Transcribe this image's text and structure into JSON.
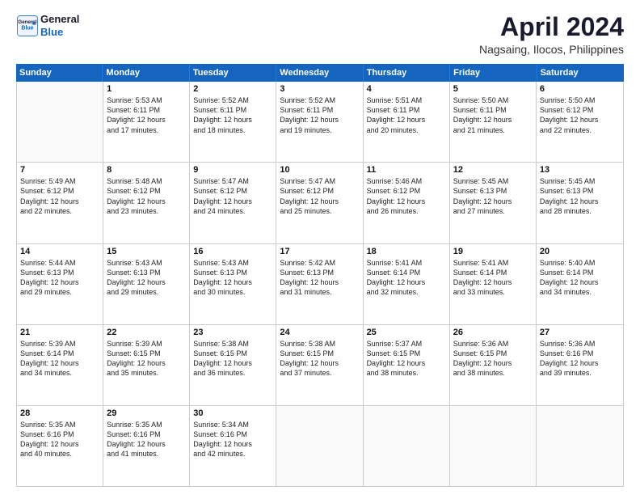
{
  "header": {
    "logo_line1": "General",
    "logo_line2": "Blue",
    "month": "April 2024",
    "location": "Nagsaing, Ilocos, Philippines"
  },
  "weekdays": [
    "Sunday",
    "Monday",
    "Tuesday",
    "Wednesday",
    "Thursday",
    "Friday",
    "Saturday"
  ],
  "rows": [
    [
      {
        "day": "",
        "lines": []
      },
      {
        "day": "1",
        "lines": [
          "Sunrise: 5:53 AM",
          "Sunset: 6:11 PM",
          "Daylight: 12 hours",
          "and 17 minutes."
        ]
      },
      {
        "day": "2",
        "lines": [
          "Sunrise: 5:52 AM",
          "Sunset: 6:11 PM",
          "Daylight: 12 hours",
          "and 18 minutes."
        ]
      },
      {
        "day": "3",
        "lines": [
          "Sunrise: 5:52 AM",
          "Sunset: 6:11 PM",
          "Daylight: 12 hours",
          "and 19 minutes."
        ]
      },
      {
        "day": "4",
        "lines": [
          "Sunrise: 5:51 AM",
          "Sunset: 6:11 PM",
          "Daylight: 12 hours",
          "and 20 minutes."
        ]
      },
      {
        "day": "5",
        "lines": [
          "Sunrise: 5:50 AM",
          "Sunset: 6:11 PM",
          "Daylight: 12 hours",
          "and 21 minutes."
        ]
      },
      {
        "day": "6",
        "lines": [
          "Sunrise: 5:50 AM",
          "Sunset: 6:12 PM",
          "Daylight: 12 hours",
          "and 22 minutes."
        ]
      }
    ],
    [
      {
        "day": "7",
        "lines": [
          "Sunrise: 5:49 AM",
          "Sunset: 6:12 PM",
          "Daylight: 12 hours",
          "and 22 minutes."
        ]
      },
      {
        "day": "8",
        "lines": [
          "Sunrise: 5:48 AM",
          "Sunset: 6:12 PM",
          "Daylight: 12 hours",
          "and 23 minutes."
        ]
      },
      {
        "day": "9",
        "lines": [
          "Sunrise: 5:47 AM",
          "Sunset: 6:12 PM",
          "Daylight: 12 hours",
          "and 24 minutes."
        ]
      },
      {
        "day": "10",
        "lines": [
          "Sunrise: 5:47 AM",
          "Sunset: 6:12 PM",
          "Daylight: 12 hours",
          "and 25 minutes."
        ]
      },
      {
        "day": "11",
        "lines": [
          "Sunrise: 5:46 AM",
          "Sunset: 6:12 PM",
          "Daylight: 12 hours",
          "and 26 minutes."
        ]
      },
      {
        "day": "12",
        "lines": [
          "Sunrise: 5:45 AM",
          "Sunset: 6:13 PM",
          "Daylight: 12 hours",
          "and 27 minutes."
        ]
      },
      {
        "day": "13",
        "lines": [
          "Sunrise: 5:45 AM",
          "Sunset: 6:13 PM",
          "Daylight: 12 hours",
          "and 28 minutes."
        ]
      }
    ],
    [
      {
        "day": "14",
        "lines": [
          "Sunrise: 5:44 AM",
          "Sunset: 6:13 PM",
          "Daylight: 12 hours",
          "and 29 minutes."
        ]
      },
      {
        "day": "15",
        "lines": [
          "Sunrise: 5:43 AM",
          "Sunset: 6:13 PM",
          "Daylight: 12 hours",
          "and 29 minutes."
        ]
      },
      {
        "day": "16",
        "lines": [
          "Sunrise: 5:43 AM",
          "Sunset: 6:13 PM",
          "Daylight: 12 hours",
          "and 30 minutes."
        ]
      },
      {
        "day": "17",
        "lines": [
          "Sunrise: 5:42 AM",
          "Sunset: 6:13 PM",
          "Daylight: 12 hours",
          "and 31 minutes."
        ]
      },
      {
        "day": "18",
        "lines": [
          "Sunrise: 5:41 AM",
          "Sunset: 6:14 PM",
          "Daylight: 12 hours",
          "and 32 minutes."
        ]
      },
      {
        "day": "19",
        "lines": [
          "Sunrise: 5:41 AM",
          "Sunset: 6:14 PM",
          "Daylight: 12 hours",
          "and 33 minutes."
        ]
      },
      {
        "day": "20",
        "lines": [
          "Sunrise: 5:40 AM",
          "Sunset: 6:14 PM",
          "Daylight: 12 hours",
          "and 34 minutes."
        ]
      }
    ],
    [
      {
        "day": "21",
        "lines": [
          "Sunrise: 5:39 AM",
          "Sunset: 6:14 PM",
          "Daylight: 12 hours",
          "and 34 minutes."
        ]
      },
      {
        "day": "22",
        "lines": [
          "Sunrise: 5:39 AM",
          "Sunset: 6:15 PM",
          "Daylight: 12 hours",
          "and 35 minutes."
        ]
      },
      {
        "day": "23",
        "lines": [
          "Sunrise: 5:38 AM",
          "Sunset: 6:15 PM",
          "Daylight: 12 hours",
          "and 36 minutes."
        ]
      },
      {
        "day": "24",
        "lines": [
          "Sunrise: 5:38 AM",
          "Sunset: 6:15 PM",
          "Daylight: 12 hours",
          "and 37 minutes."
        ]
      },
      {
        "day": "25",
        "lines": [
          "Sunrise: 5:37 AM",
          "Sunset: 6:15 PM",
          "Daylight: 12 hours",
          "and 38 minutes."
        ]
      },
      {
        "day": "26",
        "lines": [
          "Sunrise: 5:36 AM",
          "Sunset: 6:15 PM",
          "Daylight: 12 hours",
          "and 38 minutes."
        ]
      },
      {
        "day": "27",
        "lines": [
          "Sunrise: 5:36 AM",
          "Sunset: 6:16 PM",
          "Daylight: 12 hours",
          "and 39 minutes."
        ]
      }
    ],
    [
      {
        "day": "28",
        "lines": [
          "Sunrise: 5:35 AM",
          "Sunset: 6:16 PM",
          "Daylight: 12 hours",
          "and 40 minutes."
        ]
      },
      {
        "day": "29",
        "lines": [
          "Sunrise: 5:35 AM",
          "Sunset: 6:16 PM",
          "Daylight: 12 hours",
          "and 41 minutes."
        ]
      },
      {
        "day": "30",
        "lines": [
          "Sunrise: 5:34 AM",
          "Sunset: 6:16 PM",
          "Daylight: 12 hours",
          "and 42 minutes."
        ]
      },
      {
        "day": "",
        "lines": []
      },
      {
        "day": "",
        "lines": []
      },
      {
        "day": "",
        "lines": []
      },
      {
        "day": "",
        "lines": []
      }
    ]
  ]
}
